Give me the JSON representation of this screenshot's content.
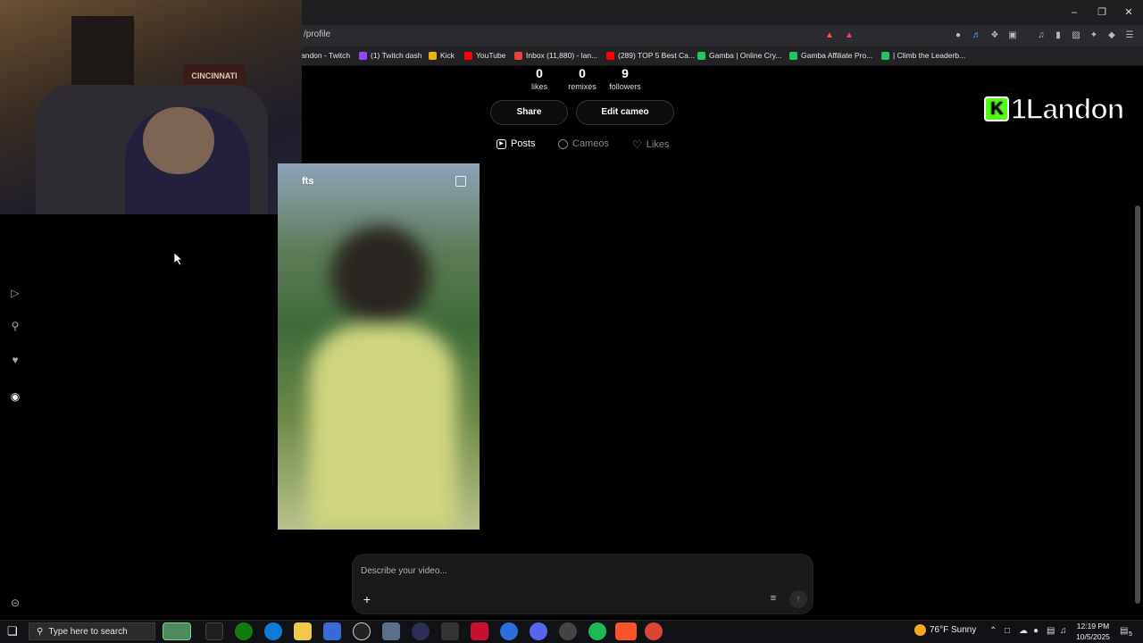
{
  "browser": {
    "url": "/profile",
    "bookmarks": [
      {
        "label": "andon - Twitch",
        "color": "#9146ff"
      },
      {
        "label": "(1) Twitch dash",
        "color": "#9146ff"
      },
      {
        "label": "Kick",
        "color": "#e8b400"
      },
      {
        "label": "YouTube",
        "color": "#ff0000"
      },
      {
        "label": "Inbox (11,880) - lan...",
        "color": "#ea4335"
      },
      {
        "label": "(289) TOP 5 Best Ca...",
        "color": "#ff0000"
      },
      {
        "label": "Gamba | Online Cry...",
        "color": "#22c55e"
      },
      {
        "label": "Gamba Affiliate Pro...",
        "color": "#22c55e"
      },
      {
        "label": "| Climb the Leaderb...",
        "color": "#22c55e"
      }
    ]
  },
  "webcam": {
    "pennant": "CINCINNATI"
  },
  "watermark": {
    "logo_letter": "K",
    "text": "1Landon"
  },
  "profile": {
    "stats": [
      {
        "value": "0",
        "label": "likes"
      },
      {
        "value": "0",
        "label": "remixes"
      },
      {
        "value": "9",
        "label": "followers"
      }
    ],
    "share_label": "Share",
    "edit_cameo_label": "Edit cameo",
    "tabs": [
      {
        "label": "Posts",
        "active": true
      },
      {
        "label": "Cameos",
        "active": false
      },
      {
        "label": "Likes",
        "active": false
      }
    ]
  },
  "video_card": {
    "title_fragment": "fts"
  },
  "composer": {
    "placeholder": "Describe your video..."
  },
  "taskbar": {
    "search_placeholder": "Type here to search",
    "weather": "76°F  Sunny",
    "time": "12:19 PM",
    "date": "10/5/2025",
    "notification_count": "5"
  }
}
